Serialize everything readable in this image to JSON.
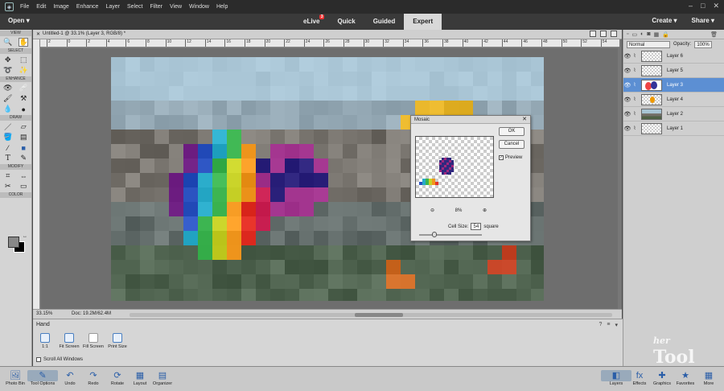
{
  "menubar": {
    "items": [
      "File",
      "Edit",
      "Image",
      "Enhance",
      "Layer",
      "Select",
      "Filter",
      "View",
      "Window",
      "Help"
    ]
  },
  "modebar": {
    "open_label": "Open",
    "tabs": [
      {
        "label": "eLive",
        "badge": "3"
      },
      {
        "label": "Quick"
      },
      {
        "label": "Guided"
      },
      {
        "label": "Expert"
      }
    ],
    "create_label": "Create",
    "share_label": "Share"
  },
  "toolbox": {
    "sections": [
      "VIEW",
      "SELECT",
      "ENHANCE",
      "DRAW",
      "MODIFY",
      "COLOR"
    ]
  },
  "document": {
    "tab_title": "Untitled-1 @ 33.1% (Layer 3, RGB/8) *",
    "ruler_ticks": [
      "2",
      "0",
      "2",
      "4",
      "6",
      "8",
      "10",
      "12",
      "14",
      "16",
      "18",
      "20",
      "22",
      "24",
      "26",
      "28",
      "30",
      "32",
      "34",
      "36",
      "38",
      "40",
      "42",
      "44",
      "46",
      "48",
      "50",
      "52",
      "54"
    ],
    "zoom": "33.15%",
    "doc_size": "Doc: 19.2M/62.4M"
  },
  "mosaic": {
    "title": "Mosaic",
    "ok_label": "OK",
    "cancel_label": "Cancel",
    "preview_label": "Preview",
    "preview_checked": true,
    "zoom_value": "8%",
    "cell_size_label": "Cell Size:",
    "cell_size_value": "54",
    "cell_size_unit": "square"
  },
  "layers_panel": {
    "blend_mode": "Normal",
    "opacity_label": "Opacity:",
    "opacity_value": "100%",
    "layers": [
      {
        "name": "Layer 6",
        "selected": false
      },
      {
        "name": "Layer 5",
        "selected": false
      },
      {
        "name": "Layer 3",
        "selected": true
      },
      {
        "name": "Layer 4",
        "selected": false
      },
      {
        "name": "Layer 2",
        "selected": false
      },
      {
        "name": "Layer 1",
        "selected": false
      }
    ]
  },
  "tool_options": {
    "tool_name": "Hand",
    "buttons": [
      {
        "label": "1:1"
      },
      {
        "label": "Fit Screen"
      },
      {
        "label": "Fill Screen"
      },
      {
        "label": "Print Size"
      }
    ],
    "scroll_all_label": "Scroll All Windows"
  },
  "bottombar": {
    "left_buttons": [
      {
        "label": "Photo Bin",
        "icon": "photo-bin-icon"
      },
      {
        "label": "Tool Options",
        "icon": "tool-options-icon"
      },
      {
        "label": "Undo",
        "icon": "undo-icon"
      },
      {
        "label": "Redo",
        "icon": "redo-icon"
      },
      {
        "label": "Rotate",
        "icon": "rotate-icon"
      },
      {
        "label": "Layout",
        "icon": "layout-icon"
      },
      {
        "label": "Organizer",
        "icon": "organizer-icon"
      }
    ],
    "right_buttons": [
      {
        "label": "Layers",
        "icon": "layers-icon"
      },
      {
        "label": "Effects",
        "icon": "effects-icon"
      },
      {
        "label": "Graphics",
        "icon": "graphics-icon"
      },
      {
        "label": "Favorites",
        "icon": "favorites-icon"
      },
      {
        "label": "More",
        "icon": "more-icon"
      }
    ]
  },
  "watermark": {
    "line1": "her",
    "line2": "Tool"
  },
  "colors": {
    "selection": "#5c8fd3",
    "accent": "#2a5ea8",
    "badge": "#ee3333"
  }
}
